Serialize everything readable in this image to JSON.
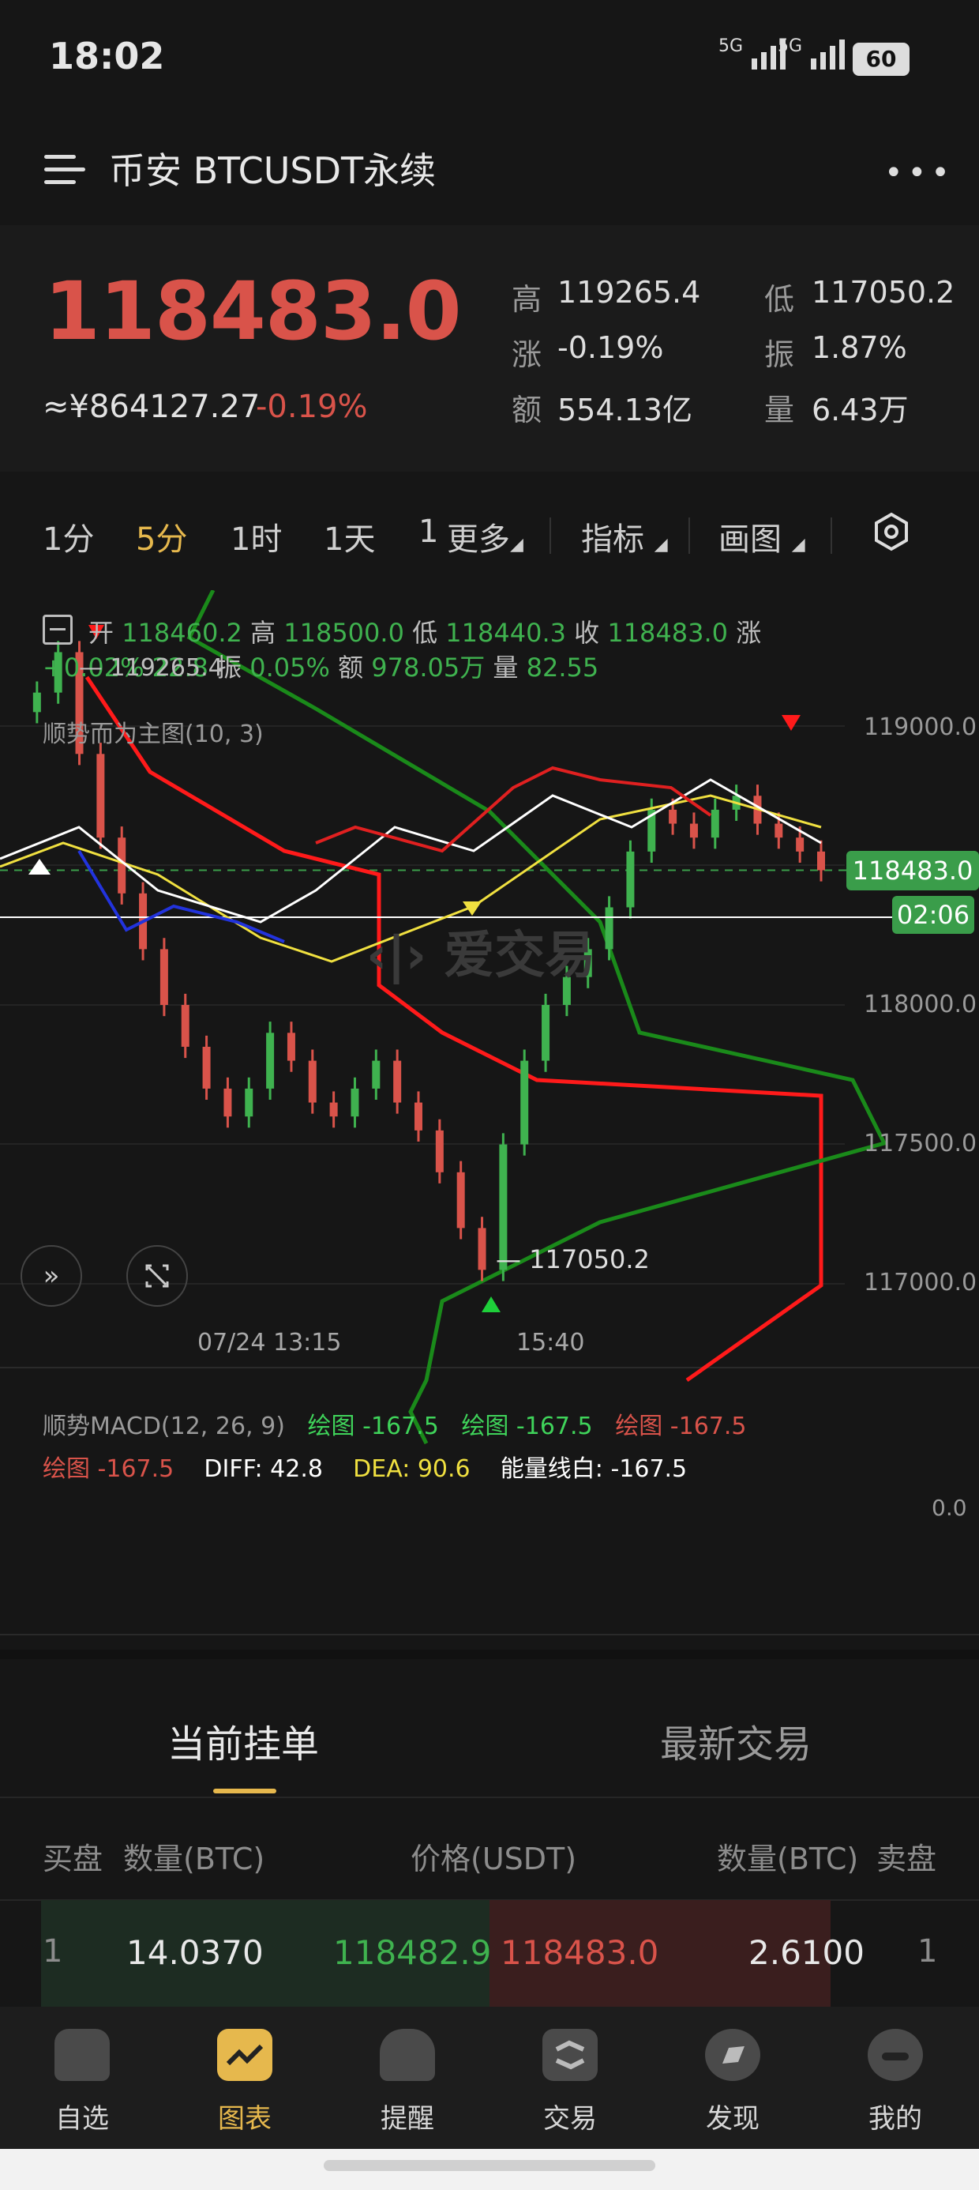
{
  "status": {
    "time": "18:02",
    "sig1": "5G",
    "sig2": "5G",
    "battery": "60"
  },
  "header": {
    "title": "币安 BTCUSDT永续",
    "more": "•••"
  },
  "ticker": {
    "last": "118483.0",
    "cny": "≈¥864127.27",
    "change_pct": "-0.19%",
    "stats": [
      {
        "k": "高",
        "v": "119265.4"
      },
      {
        "k": "低",
        "v": "117050.2"
      },
      {
        "k": "涨",
        "v": "-0.19%"
      },
      {
        "k": "振",
        "v": "1.87%"
      },
      {
        "k": "额",
        "v": "554.13亿"
      },
      {
        "k": "量",
        "v": "6.43万"
      }
    ]
  },
  "tabs": {
    "items": [
      "1分",
      "5分",
      "1时",
      "1天",
      "1",
      "更多",
      "指标",
      "画图"
    ],
    "active": "5分"
  },
  "legend": {
    "open_k": "开",
    "open_v": "118460.2",
    "high_k": "高",
    "high_v": "118500.0",
    "low_k": "低",
    "low_v": "118440.3",
    "close_k": "收",
    "close_v": "118483.0",
    "chg_k": "涨",
    "chg_v": "+0.02%",
    "chg_extra": "22.8",
    "amp_k": "振",
    "amp_v": "0.05%",
    "amt_k": "额",
    "amt_v": "978.05万",
    "vol_k": "量",
    "vol_v": "82.55",
    "high_mark": "119265.4",
    "low_mark": "117050.2",
    "indicator": "顺势而为主图(10, 3)",
    "watermark": "爱交易"
  },
  "price_axis": [
    "119000.0",
    "118500.0",
    "118000.0",
    "117500.0",
    "117000.0"
  ],
  "price_tag": "118483.0",
  "countdown": "02:06",
  "time_axis": [
    "07/24 13:15",
    "15:40"
  ],
  "macd": {
    "title": "顺势MACD(12, 26, 9)",
    "l1": "绘图 -167.5",
    "l2": "绘图 -167.5",
    "l3": "绘图 -167.5",
    "l4": "绘图 -167.5",
    "diff": "DIFF: 42.8",
    "dea": "DEA: 90.6",
    "energy": "能量线白: -167.5",
    "zero": "0.0"
  },
  "book": {
    "tab_active": "当前挂单",
    "tab_other": "最新交易",
    "headers": [
      "买盘",
      "数量(BTC)",
      "价格(USDT)",
      "数量(BTC)",
      "卖盘"
    ],
    "row": {
      "bid_idx": "1",
      "bid_qty": "14.0370",
      "bid_px": "118482.9",
      "ask_px": "118483.0",
      "ask_qty": "2.6100",
      "ask_idx": "1"
    }
  },
  "nav": [
    "自选",
    "图表",
    "提醒",
    "交易",
    "发现",
    "我的"
  ],
  "colors": {
    "up": "#3fb24f",
    "down": "#d9534a",
    "accent": "#e6b84d",
    "bg": "#161616"
  }
}
